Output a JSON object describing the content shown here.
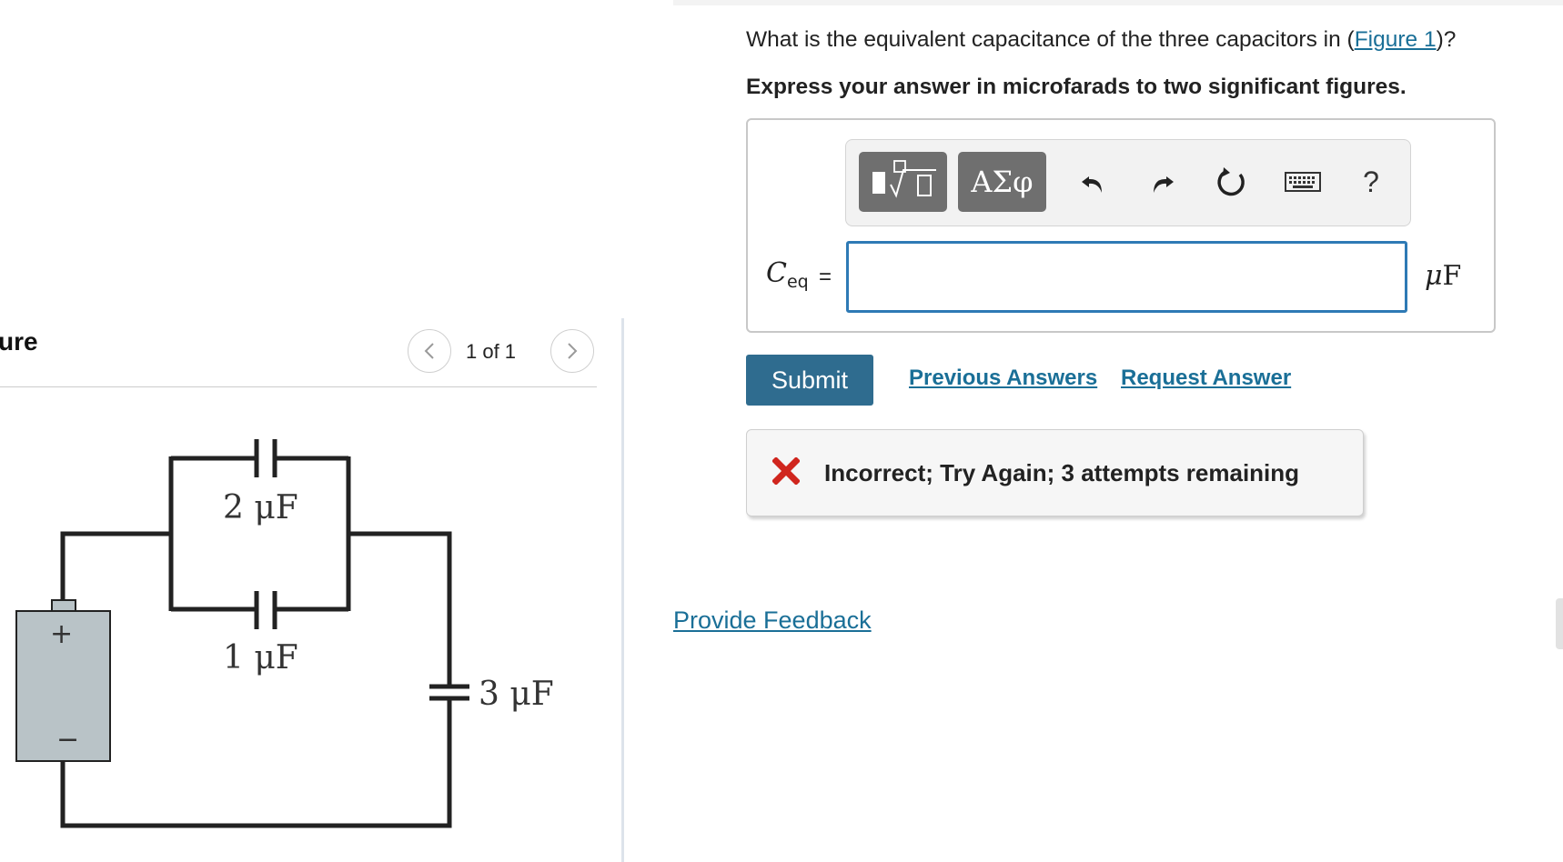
{
  "figure": {
    "heading": "ure",
    "pager": {
      "prev_icon": "chevron-left-icon",
      "count": "1 of 1",
      "next_icon": "chevron-right-icon"
    },
    "circuit": {
      "capacitor_2_label": "2 μF",
      "capacitor_1_label": "1 μF",
      "capacitor_3_label": "3 μF",
      "battery_plus": "+",
      "battery_minus": "−",
      "battery_color": "#b9c3c7"
    }
  },
  "question": {
    "text_before": "What is the equivalent capacitance of the three capacitors in (",
    "figure_link": "Figure 1",
    "text_after": ")?",
    "instruction": "Express your answer in microfarads to two significant figures."
  },
  "toolbar": {
    "templates_icon": "templates-sqrt-icon",
    "symbols_label": "ΑΣφ",
    "undo_icon": "undo-icon",
    "redo_icon": "redo-icon",
    "reset_icon": "reset-icon",
    "keyboard_icon": "keyboard-icon",
    "help_label": "?"
  },
  "answer": {
    "label_main": "C",
    "label_sub": "eq",
    "equals": "=",
    "value": "",
    "unit_mu": "μ",
    "unit_F": "F"
  },
  "actions": {
    "submit_label": "Submit",
    "previous_answers_label": "Previous Answers",
    "request_answer_label": "Request Answer"
  },
  "feedback": {
    "icon": "x-mark-icon",
    "text": "Incorrect; Try Again; 3 attempts remaining",
    "icon_color": "#d0261e"
  },
  "footer": {
    "provide_feedback_label": "Provide Feedback"
  },
  "colors": {
    "link": "#1a6f97",
    "submit": "#2f6c8f",
    "input_border": "#2e7ab5"
  }
}
